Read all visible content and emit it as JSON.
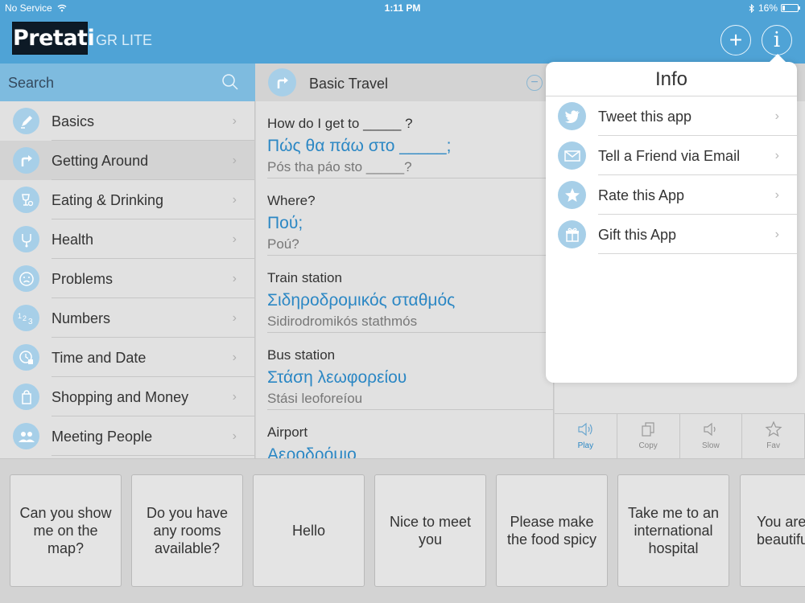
{
  "status": {
    "carrier": "No Service",
    "time": "1:11 PM",
    "battery": "16%"
  },
  "header": {
    "logo": "Pretati",
    "subtitle": "GR LITE"
  },
  "search": {
    "placeholder": "Search"
  },
  "sidebar": {
    "items": [
      {
        "label": "Basics",
        "icon": "pencil-icon"
      },
      {
        "label": "Getting Around",
        "icon": "turn-arrow-icon"
      },
      {
        "label": "Eating & Drinking",
        "icon": "glass-icon"
      },
      {
        "label": "Health",
        "icon": "stethoscope-icon"
      },
      {
        "label": "Problems",
        "icon": "sad-face-icon"
      },
      {
        "label": "Numbers",
        "icon": "numbers-icon"
      },
      {
        "label": "Time and Date",
        "icon": "clock-icon"
      },
      {
        "label": "Shopping and Money",
        "icon": "shopping-bag-icon"
      },
      {
        "label": "Meeting People",
        "icon": "people-icon"
      }
    ]
  },
  "category": {
    "title": "Basic Travel"
  },
  "phrases": [
    {
      "en": "How do I get to _____ ?",
      "gr": "Πώς θα πάω στο _____;",
      "tr": "Pós tha páo sto _____?"
    },
    {
      "en": "Where?",
      "gr": "Πού;",
      "tr": "Poú?"
    },
    {
      "en": "Train station",
      "gr": "Σιδηροδρομικός σταθμός",
      "tr": "Sidirodromikós stathmós"
    },
    {
      "en": "Bus station",
      "gr": "Στάση λεωφορείου",
      "tr": "Stási leoforeíou"
    },
    {
      "en": "Airport",
      "gr": "Αεροδρόμιο",
      "tr": ""
    }
  ],
  "actions": [
    {
      "label": "Play",
      "icon": "speaker-icon"
    },
    {
      "label": "Copy",
      "icon": "copy-icon"
    },
    {
      "label": "Slow",
      "icon": "speaker-slow-icon"
    },
    {
      "label": "Fav",
      "icon": "star-icon"
    }
  ],
  "info": {
    "title": "Info",
    "items": [
      {
        "label": "Tweet this app",
        "icon": "twitter-icon"
      },
      {
        "label": "Tell a Friend via Email",
        "icon": "envelope-icon"
      },
      {
        "label": "Rate this App",
        "icon": "star-icon"
      },
      {
        "label": "Gift this App",
        "icon": "gift-icon"
      }
    ]
  },
  "favorites": [
    "Can you show me on the map?",
    "Do you have any rooms available?",
    "Hello",
    "Nice to meet you",
    "Please make the food spicy",
    "Take me to an international hospital",
    "You are beautiful"
  ],
  "colors": {
    "header": "#4fa3d6",
    "accent": "#2b87c4",
    "icon_bg": "#a7cfe8"
  }
}
